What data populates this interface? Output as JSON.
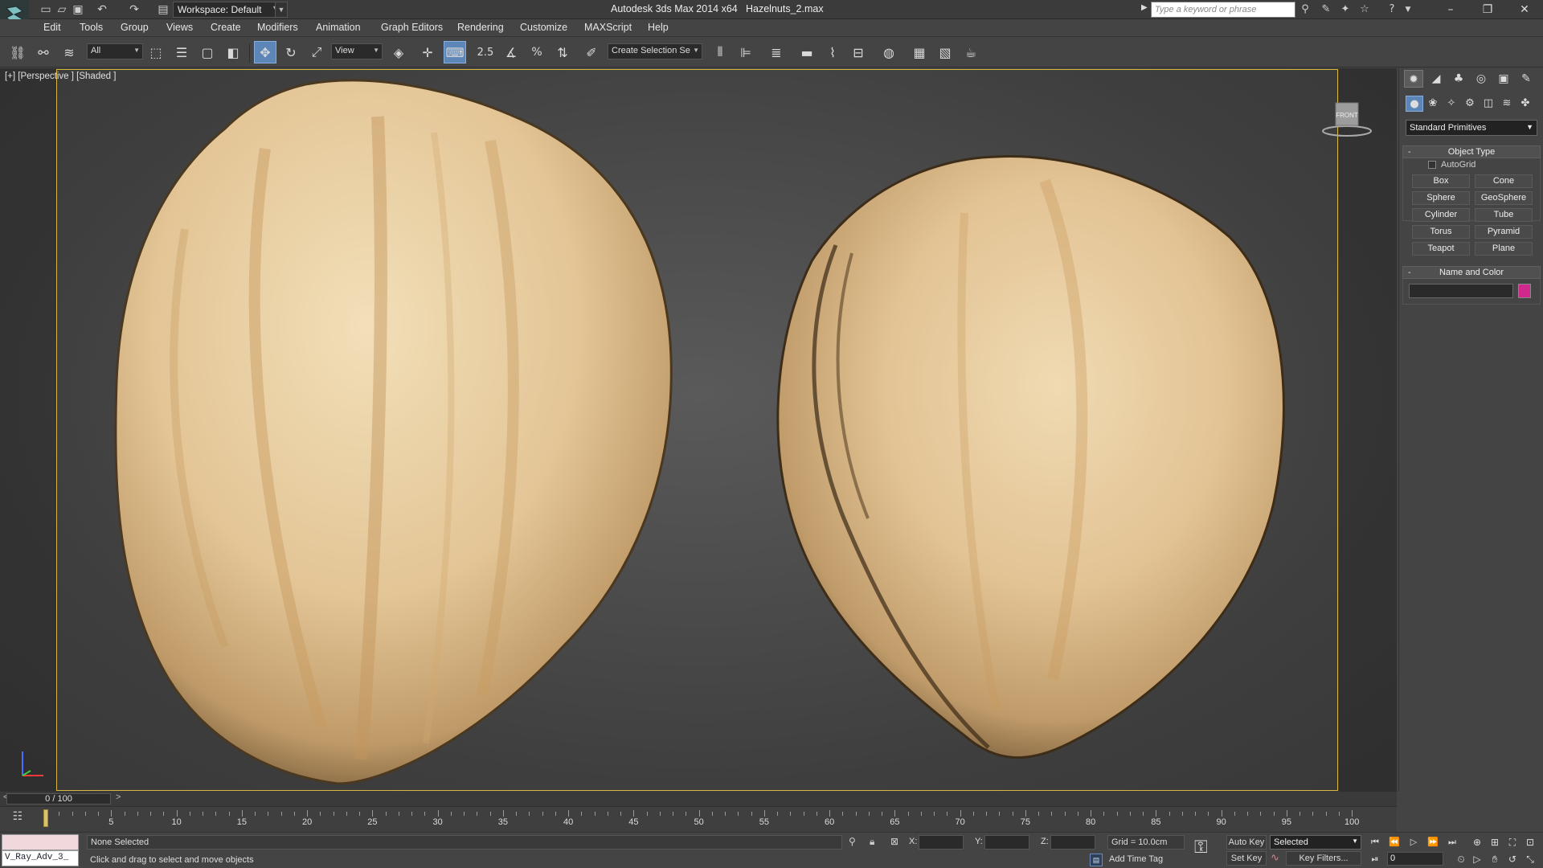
{
  "app": {
    "title": "Autodesk 3ds Max  2014 x64",
    "file": "Hazelnuts_2.max",
    "workspace": "Workspace: Default"
  },
  "search": {
    "placeholder": "Type a keyword or phrase"
  },
  "menu": [
    "Edit",
    "Tools",
    "Group",
    "Views",
    "Create",
    "Modifiers",
    "Animation",
    "Graph Editors",
    "Rendering",
    "Customize",
    "MAXScript",
    "Help"
  ],
  "toolbar": {
    "selection_filter": "All",
    "ref_coord": "View",
    "snap_value": "2.5",
    "named_selection": "Create Selection Se"
  },
  "viewport": {
    "label": "[+] [Perspective ] [Shaded ]",
    "viewcube_face": "FRONT"
  },
  "command_panel": {
    "category": "Standard Primitives",
    "object_type_title": "Object Type",
    "autogrid_label": "AutoGrid",
    "primitives": [
      "Box",
      "Cone",
      "Sphere",
      "GeoSphere",
      "Cylinder",
      "Tube",
      "Torus",
      "Pyramid",
      "Teapot",
      "Plane"
    ],
    "name_color_title": "Name and Color",
    "object_color": "#d0288c"
  },
  "timeline": {
    "slider_label": "0 / 100",
    "ticks": [
      "5",
      "10",
      "15",
      "20",
      "25",
      "30",
      "35",
      "40",
      "45",
      "50",
      "55",
      "60",
      "65",
      "70",
      "75",
      "80",
      "85",
      "90",
      "95",
      "100"
    ]
  },
  "status": {
    "maxscript_text": "V_Ray_Adv_3_",
    "selection": "None Selected",
    "prompt": "Click and drag to select and move objects",
    "x_label": "X:",
    "y_label": "Y:",
    "z_label": "Z:",
    "grid": "Grid = 10.0cm",
    "add_time_tag": "Add Time Tag",
    "auto_key": "Auto Key",
    "set_key": "Set Key",
    "selected_mode": "Selected",
    "key_filters": "Key Filters...",
    "current_frame": "0"
  },
  "colors": {
    "accent_active": "#5d86b8",
    "viewport_border": "#d8b83c"
  }
}
